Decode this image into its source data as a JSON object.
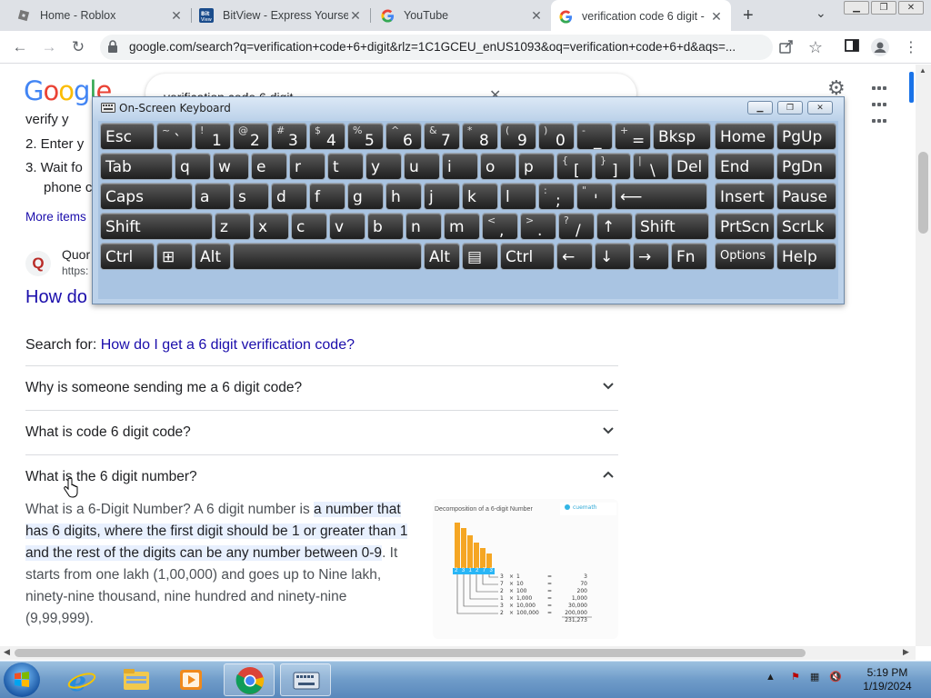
{
  "tabs": [
    {
      "label": "Home - Roblox"
    },
    {
      "label": "BitView - Express Yourself"
    },
    {
      "label": "YouTube"
    },
    {
      "label": "verification code 6 digit -"
    }
  ],
  "address": {
    "url": "google.com/search?q=verification+code+6+digit&rlz=1C1GCEU_enUS1093&oq=verification+code+6+d&aqs=..."
  },
  "search": {
    "query": "verification code 6 digit"
  },
  "logo": [
    "G",
    "o",
    "o",
    "g",
    "l",
    "e"
  ],
  "results": {
    "list_items": [
      "verify y",
      "2. Enter y",
      "3. Wait fo",
      "phone c"
    ],
    "more_items": "More items",
    "quora_name": "Quor",
    "quora_url": "https:",
    "title": "How do",
    "search_for_label": "Search for:",
    "search_for_link": "How do I get a 6 digit verification code?"
  },
  "paa": [
    {
      "question": "Why is someone sending me a 6 digit code?",
      "expanded": false
    },
    {
      "question": "What is code 6 digit code?",
      "expanded": false
    },
    {
      "question": "What is the 6 digit number?",
      "expanded": true
    }
  ],
  "answer": {
    "prefix": "What is a 6-Digit Number? A 6 digit number is ",
    "highlight": "a number that has 6 digits, where the first digit should be 1 or greater than 1 and the rest of the digits can be any number between 0-9",
    "suffix": ". It starts from one lakh (1,00,000) and goes up to Nine lakh, ninety-nine thousand, nine hundred and ninety-nine (9,99,999)."
  },
  "answer_image": {
    "title": "Decomposition of a 6-digit Number",
    "rows": [
      {
        "d": "3",
        "p": "1",
        "v": "3"
      },
      {
        "d": "7",
        "p": "10",
        "v": "70"
      },
      {
        "d": "2",
        "p": "100",
        "v": "200"
      },
      {
        "d": "1",
        "p": "1,000",
        "v": "1,000"
      },
      {
        "d": "3",
        "p": "10,000",
        "v": "30,000"
      },
      {
        "d": "2",
        "p": "100,000",
        "v": "200,000"
      }
    ],
    "total": "231,273",
    "digits": [
      "2",
      "3",
      "1",
      "2",
      "7",
      "3"
    ]
  },
  "osk": {
    "title": "On-Screen Keyboard"
  },
  "keys": {
    "row1": [
      {
        "l": "Esc"
      },
      {
        "s": "~",
        "m": "`"
      },
      {
        "s": "!",
        "m": "1"
      },
      {
        "s": "@",
        "m": "2"
      },
      {
        "s": "#",
        "m": "3"
      },
      {
        "s": "$",
        "m": "4"
      },
      {
        "s": "%",
        "m": "5"
      },
      {
        "s": "^",
        "m": "6"
      },
      {
        "s": "&",
        "m": "7"
      },
      {
        "s": "*",
        "m": "8"
      },
      {
        "s": "(",
        "m": "9"
      },
      {
        "s": ")",
        "m": "0"
      },
      {
        "s": "-",
        "m": "_"
      },
      {
        "s": "+",
        "m": "="
      },
      {
        "l": "Bksp"
      },
      {
        "l": "Home"
      },
      {
        "l": "PgUp"
      }
    ],
    "row2": [
      {
        "l": "Tab"
      },
      {
        "l": "q"
      },
      {
        "l": "w"
      },
      {
        "l": "e"
      },
      {
        "l": "r"
      },
      {
        "l": "t"
      },
      {
        "l": "y"
      },
      {
        "l": "u"
      },
      {
        "l": "i"
      },
      {
        "l": "o"
      },
      {
        "l": "p"
      },
      {
        "s": "{",
        "m": "["
      },
      {
        "s": "}",
        "m": "]"
      },
      {
        "s": "|",
        "m": "\\"
      },
      {
        "l": "Del"
      },
      {
        "l": "End"
      },
      {
        "l": "PgDn"
      }
    ],
    "row3": [
      {
        "l": "Caps"
      },
      {
        "l": "a"
      },
      {
        "l": "s"
      },
      {
        "l": "d"
      },
      {
        "l": "f"
      },
      {
        "l": "g"
      },
      {
        "l": "h"
      },
      {
        "l": "j"
      },
      {
        "l": "k"
      },
      {
        "l": "l"
      },
      {
        "s": ":",
        "m": ";"
      },
      {
        "s": "\"",
        "m": "'"
      },
      {
        "l": "⟵"
      },
      {
        "l": "Insert"
      },
      {
        "l": "Pause"
      }
    ],
    "row4": [
      {
        "l": "Shift"
      },
      {
        "l": "z"
      },
      {
        "l": "x"
      },
      {
        "l": "c"
      },
      {
        "l": "v"
      },
      {
        "l": "b"
      },
      {
        "l": "n"
      },
      {
        "l": "m"
      },
      {
        "s": "<",
        "m": ","
      },
      {
        "s": ">",
        "m": "."
      },
      {
        "s": "?",
        "m": "/"
      },
      {
        "l": "↑"
      },
      {
        "l": "Shift"
      },
      {
        "l": "PrtScn"
      },
      {
        "l": "ScrLk"
      }
    ],
    "row5": [
      {
        "l": "Ctrl"
      },
      {
        "l": "⊞"
      },
      {
        "l": "Alt"
      },
      {
        "l": ""
      },
      {
        "l": "Alt"
      },
      {
        "l": "▤"
      },
      {
        "l": "Ctrl"
      },
      {
        "l": "←"
      },
      {
        "l": "↓"
      },
      {
        "l": "→"
      },
      {
        "l": "Fn"
      },
      {
        "l": "Options",
        "small": true
      },
      {
        "l": "Help"
      }
    ]
  },
  "taskbar": {
    "time": "5:19 PM",
    "date": "1/19/2024"
  },
  "colors": {
    "link": "#1a0dab",
    "google_blue": "#4285f4",
    "osk_bg": "#bcd2ea",
    "key_dark": "#1e1e1e"
  }
}
